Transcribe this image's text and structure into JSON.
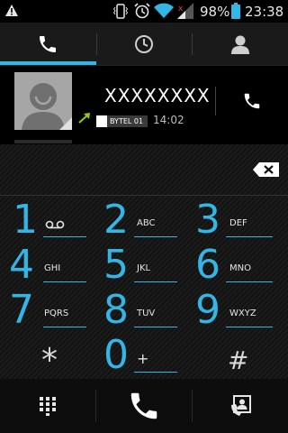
{
  "status_bar": {
    "battery_percent": "98%",
    "time": "23:38",
    "icons": [
      "warning-icon",
      "vibrate-icon",
      "alarm-icon",
      "wifi-icon",
      "signal-icon",
      "battery-icon"
    ]
  },
  "tabs": [
    {
      "icon": "phone-icon",
      "selected": true
    },
    {
      "icon": "clock-icon",
      "selected": false
    },
    {
      "icon": "contact-icon",
      "selected": false
    }
  ],
  "recent_call": {
    "contact_name": "XXXXXXXX",
    "sim_label": "BYTEL 01",
    "time": "14:02",
    "direction_icon": "outgoing-call-icon"
  },
  "dialpad": {
    "keys": [
      {
        "digit": "1",
        "letters": ""
      },
      {
        "digit": "2",
        "letters": "ABC"
      },
      {
        "digit": "3",
        "letters": "DEF"
      },
      {
        "digit": "4",
        "letters": "GHI"
      },
      {
        "digit": "5",
        "letters": "JKL"
      },
      {
        "digit": "6",
        "letters": "MNO"
      },
      {
        "digit": "7",
        "letters": "PQRS"
      },
      {
        "digit": "8",
        "letters": "TUV"
      },
      {
        "digit": "9",
        "letters": "WXYZ"
      },
      {
        "digit": "*",
        "letters": ""
      },
      {
        "digit": "0",
        "letters": "+"
      },
      {
        "digit": "#",
        "letters": ""
      }
    ]
  },
  "colors": {
    "accent": "#33b5e5",
    "call_green": "#99cc00"
  }
}
